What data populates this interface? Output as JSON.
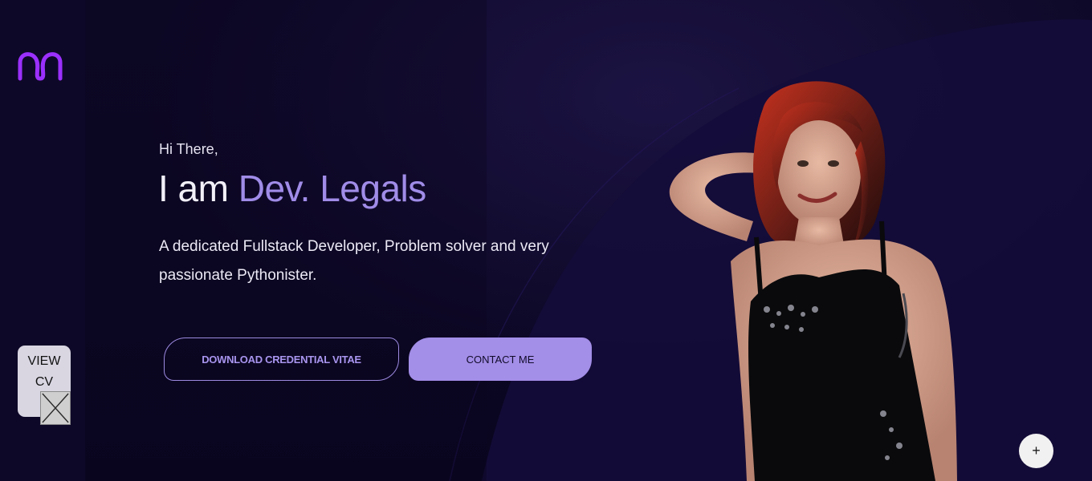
{
  "brand": {
    "logo_icon": "m-logo-icon",
    "accent": "#9b30ff"
  },
  "sidebar": {
    "view_cv_label": "VIEW CV"
  },
  "hero": {
    "greeting": "Hi There,",
    "headline_prefix": "I am ",
    "name": "Dev. Legals",
    "tagline": "A dedicated Fullstack Developer, Problem solver and very passionate Pythonister.",
    "download_button": "DOWNLOAD CREDENTIAL VITAE",
    "contact_button": "CONTACT ME",
    "name_color": "#a08ce8",
    "button_color": "#a38ee8"
  },
  "fab": {
    "label": "+"
  }
}
